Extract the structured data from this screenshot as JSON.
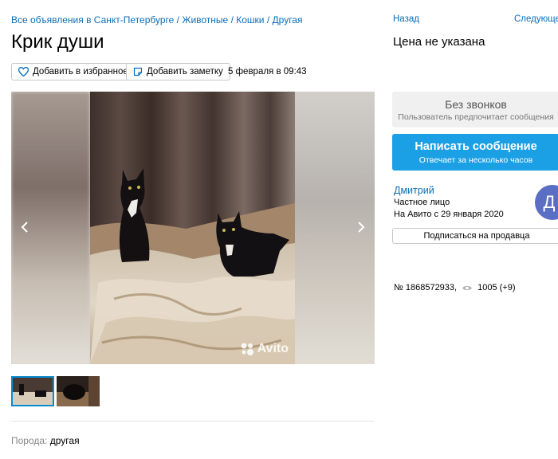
{
  "breadcrumb": {
    "items": [
      "Все объявления в Санкт-Петербурге",
      "Животные",
      "Кошки",
      "Другая"
    ],
    "separator": "/"
  },
  "title": "Крик души",
  "actions": {
    "favorite_label": "Добавить в избранное",
    "note_label": "Добавить заметку",
    "date": "5 февраля в 09:43"
  },
  "gallery": {
    "watermark": "Avito",
    "thumbnails_count": 2,
    "selected_thumbnail": 1
  },
  "params": [
    {
      "key": "Порода:",
      "value": "другая"
    }
  ],
  "nav": {
    "back": "Назад",
    "next": "Следующее"
  },
  "price": "Цена не указана",
  "no_calls": {
    "title": "Без звонков",
    "subtitle": "Пользователь предпочитает сообщения"
  },
  "message_button": {
    "title": "Написать сообщение",
    "subtitle": "Отвечает за несколько часов"
  },
  "seller": {
    "name": "Дмитрий",
    "type": "Частное лицо",
    "since": "На Авито с 29 января 2020",
    "avatar_letter": "Д",
    "subscribe_label": "Подписаться на продавца"
  },
  "listing_meta": {
    "number": "№ 1868572933,",
    "views": "1005 (+9)"
  },
  "colors": {
    "link": "#0a6eb8",
    "primary_button": "#1ca0e5",
    "avatar": "#5a6fc4",
    "thumbnail_selected_border": "#0a8bd1"
  }
}
